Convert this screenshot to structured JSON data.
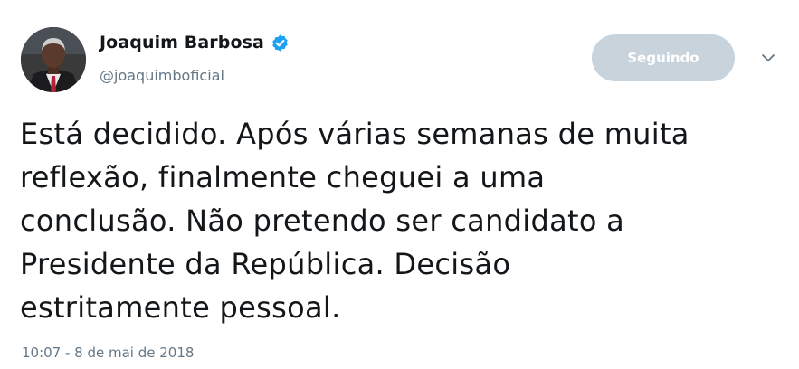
{
  "author": {
    "display_name": "Joaquim Barbosa",
    "handle": "@joaquimboficial",
    "verified_icon": "verified-badge-icon",
    "avatar_icon": "profile-photo"
  },
  "actions": {
    "follow_label": "Seguindo",
    "menu_icon": "chevron-down-icon"
  },
  "tweet": {
    "lines": [
      "Está decidido. Após várias semanas de muita",
      "reflexão, finalmente cheguei a uma",
      "conclusão. Não pretendo ser candidato a",
      "Presidente da República. Decisão",
      "estritamente pessoal."
    ],
    "timestamp": "10:07 - 8 de mai de 2018"
  },
  "colors": {
    "verified": "#1da1f2",
    "follow_button_bg": "#c8d3dc",
    "secondary_text": "#657786",
    "primary_text": "#14171a"
  }
}
